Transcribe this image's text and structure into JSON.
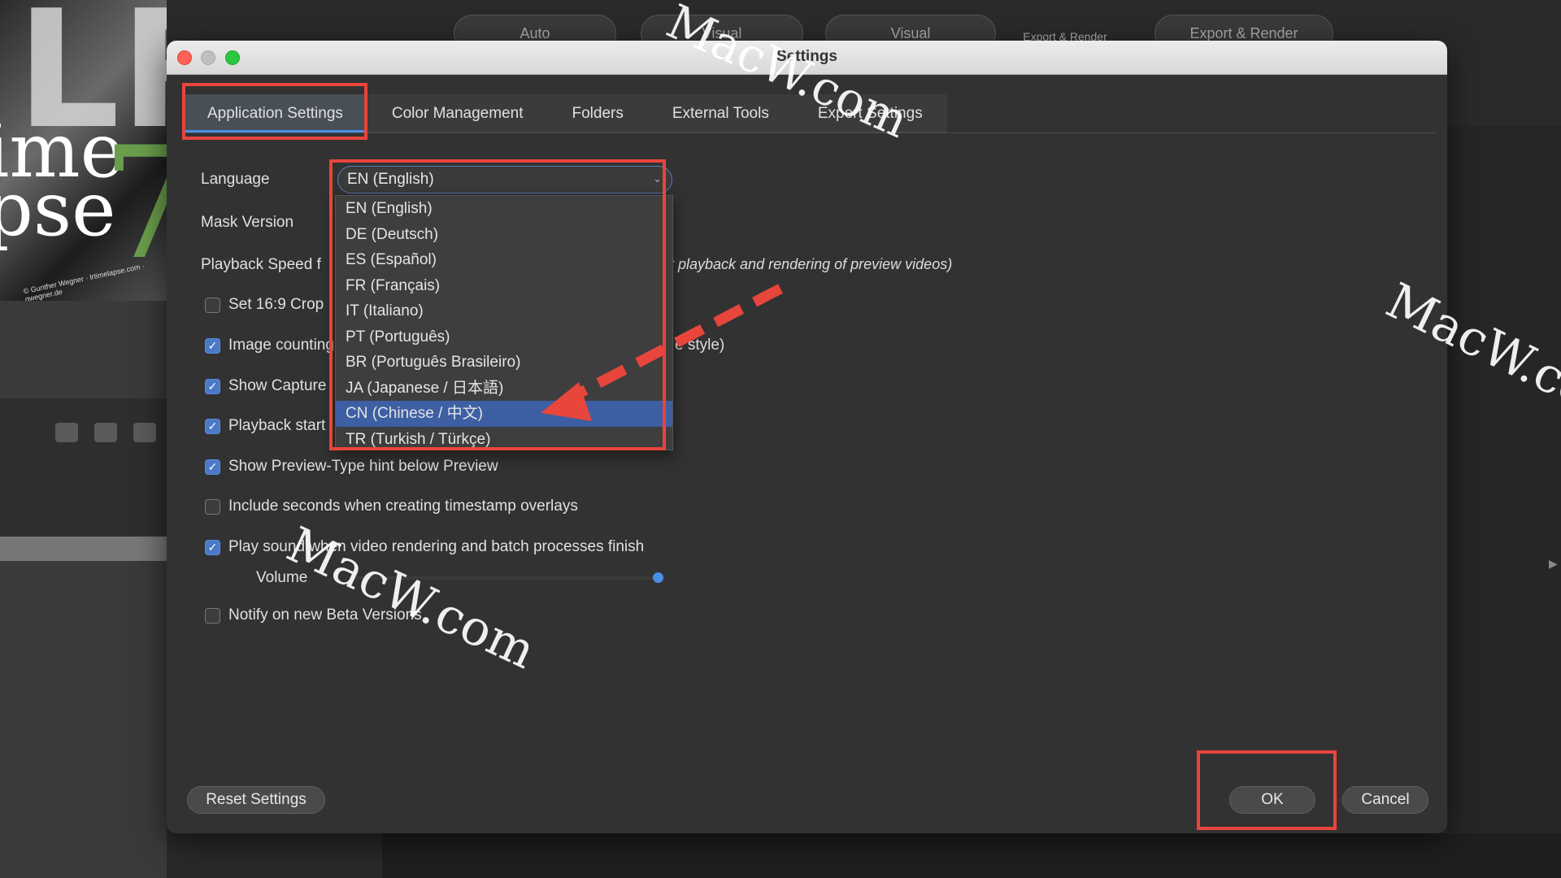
{
  "background": {
    "logo_lr": "LR",
    "logo_name_line1": "ime",
    "logo_name_line2": "pse",
    "logo_seven": "7",
    "logo_credit": "© Gunther Wegner · lrtimelapse.com · gwegner.de",
    "toolbar": [
      "Auto",
      "Visual",
      "Visual",
      "Export & Render",
      "Export & Render"
    ]
  },
  "dialog": {
    "title": "Settings",
    "tabs": [
      "Application Settings",
      "Color Management",
      "Folders",
      "External Tools",
      "Expert Settings"
    ],
    "active_tab": "Application Settings",
    "language_label": "Language",
    "mask_version_label": "Mask Version",
    "playback_speed_label": "Playback Speed f",
    "playback_note": "ct playback and rendering of preview videos)",
    "style_note": "e style)",
    "language_select": {
      "value": "EN (English)",
      "options": [
        "EN (English)",
        "DE (Deutsch)",
        "ES (Español)",
        "FR (Français)",
        "IT (Italiano)",
        "PT (Português)",
        "BR (Português Brasileiro)",
        "JA (Japanese / 日本語)",
        "CN (Chinese / 中文)",
        "TR (Turkish / Türkçe)"
      ],
      "highlighted": "CN (Chinese / 中文)"
    },
    "checkboxes": [
      {
        "label": "Set 16:9 Crop",
        "checked": false
      },
      {
        "label": "Image counting",
        "checked": true
      },
      {
        "label": "Show Capture",
        "checked": true
      },
      {
        "label": "Playback start",
        "checked": true
      },
      {
        "label": "Show Preview-Type hint below Preview",
        "checked": true
      },
      {
        "label": "Include seconds when creating timestamp overlays",
        "checked": false
      },
      {
        "label": "Play sound when video rendering and batch processes finish",
        "checked": true
      },
      {
        "label": "Notify on new Beta Versions",
        "checked": false
      }
    ],
    "volume_label": "Volume",
    "volume_level": 1.0,
    "reset_button": "Reset Settings",
    "ok_button": "OK",
    "cancel_button": "Cancel"
  },
  "watermarks": [
    "MacW.com",
    "MacW.com",
    "MacW.co"
  ],
  "colors": {
    "annotation": "#e8453c",
    "accent": "#4a8fe6",
    "selection": "#3d5fa3"
  }
}
